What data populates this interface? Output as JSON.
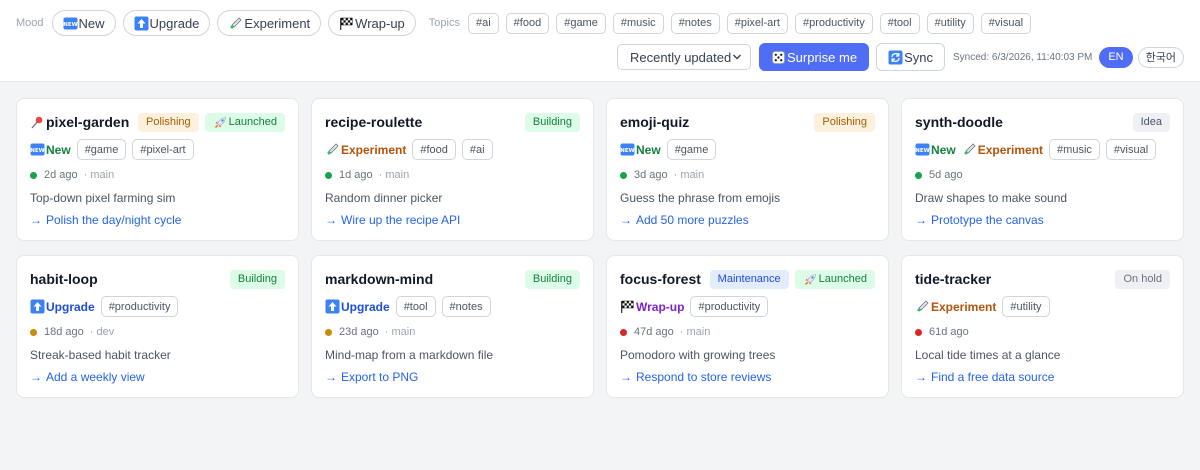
{
  "filters": {
    "mood_label": "Mood",
    "moods": [
      {
        "label": "New",
        "icon": "new-icon"
      },
      {
        "label": "Upgrade",
        "icon": "up-arrow-icon"
      },
      {
        "label": "Experiment",
        "icon": "test-tube-icon"
      },
      {
        "label": "Wrap-up",
        "icon": "checkered-flag-icon"
      }
    ],
    "topics_label": "Topics",
    "topics": [
      "#ai",
      "#food",
      "#game",
      "#music",
      "#notes",
      "#pixel-art",
      "#productivity",
      "#tool",
      "#utility",
      "#visual"
    ]
  },
  "toolbar": {
    "sort_value": "Recently updated",
    "surprise_label": "Surprise me",
    "sync_label": "Sync",
    "synced_text": "Synced: 6/3/2026, 11:40:03 PM",
    "lang_en": "EN",
    "lang_ko": "한국어"
  },
  "colors": {
    "accent": "#4f6df5",
    "link": "#2563eb"
  },
  "projects": [
    {
      "name": "pixel-garden",
      "pinned": true,
      "status": "Polishing",
      "launched": "Launched",
      "mood": "New",
      "tags": [
        "#game",
        "#pixel-art"
      ],
      "age": "2d ago",
      "branch": "· main",
      "health": "green",
      "desc": "Top-down pixel farming sim",
      "next": "Polish the day/night cycle"
    },
    {
      "name": "recipe-roulette",
      "status": "Building",
      "mood": "Experiment",
      "tags": [
        "#food",
        "#ai"
      ],
      "age": "1d ago",
      "branch": "· main",
      "health": "green",
      "desc": "Random dinner picker",
      "next": "Wire up the recipe API"
    },
    {
      "name": "emoji-quiz",
      "status": "Polishing",
      "mood": "New",
      "tags": [
        "#game"
      ],
      "age": "3d ago",
      "branch": "· main",
      "health": "green",
      "desc": "Guess the phrase from emojis",
      "next": "Add 50 more puzzles"
    },
    {
      "name": "synth-doodle",
      "status": "Idea",
      "mood": "New",
      "mood2": "Experiment",
      "tags": [
        "#music",
        "#visual"
      ],
      "age": "5d ago",
      "health": "green",
      "desc": "Draw shapes to make sound",
      "next": "Prototype the canvas"
    },
    {
      "name": "habit-loop",
      "status": "Building",
      "mood": "Upgrade",
      "tags": [
        "#productivity"
      ],
      "age": "18d ago",
      "branch": "· dev",
      "health": "yellow",
      "desc": "Streak-based habit tracker",
      "next": "Add a weekly view"
    },
    {
      "name": "markdown-mind",
      "status": "Building",
      "mood": "Upgrade",
      "tags": [
        "#tool",
        "#notes"
      ],
      "age": "23d ago",
      "branch": "· main",
      "health": "yellow",
      "desc": "Mind-map from a markdown file",
      "next": "Export to PNG"
    },
    {
      "name": "focus-forest",
      "status": "Maintenance",
      "launched": "Launched",
      "mood": "Wrap-up",
      "tags": [
        "#productivity"
      ],
      "age": "47d ago",
      "branch": "· main",
      "health": "red",
      "desc": "Pomodoro with growing trees",
      "next": "Respond to store reviews"
    },
    {
      "name": "tide-tracker",
      "status": "On hold",
      "mood": "Experiment",
      "tags": [
        "#utility"
      ],
      "age": "61d ago",
      "health": "red",
      "desc": "Local tide times at a glance",
      "next": "Find a free data source"
    }
  ]
}
